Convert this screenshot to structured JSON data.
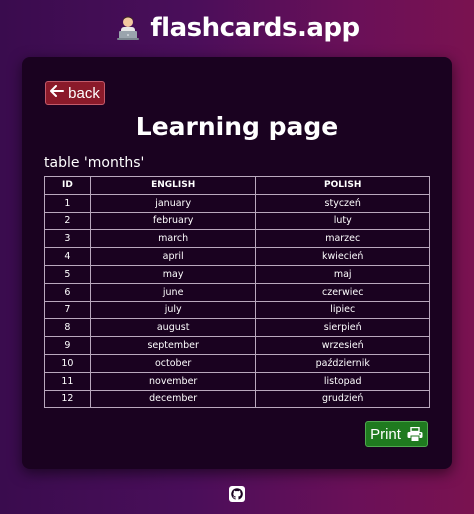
{
  "app": {
    "title": "flashcards.app",
    "logo_icon": "person-at-laptop-icon"
  },
  "card": {
    "back_label": "back",
    "back_icon": "arrow-left-icon",
    "page_title": "Learning page",
    "table_caption": "table 'months'",
    "columns": [
      "ID",
      "ENGLISH",
      "POLISH"
    ],
    "rows": [
      {
        "id": "1",
        "english": "january",
        "polish": "styczeń"
      },
      {
        "id": "2",
        "english": "february",
        "polish": "luty"
      },
      {
        "id": "3",
        "english": "march",
        "polish": "marzec"
      },
      {
        "id": "4",
        "english": "april",
        "polish": "kwiecień"
      },
      {
        "id": "5",
        "english": "may",
        "polish": "maj"
      },
      {
        "id": "6",
        "english": "june",
        "polish": "czerwiec"
      },
      {
        "id": "7",
        "english": "july",
        "polish": "lipiec"
      },
      {
        "id": "8",
        "english": "august",
        "polish": "sierpień"
      },
      {
        "id": "9",
        "english": "september",
        "polish": "wrzesień"
      },
      {
        "id": "10",
        "english": "october",
        "polish": "październik"
      },
      {
        "id": "11",
        "english": "november",
        "polish": "listopad"
      },
      {
        "id": "12",
        "english": "december",
        "polish": "grudzień"
      }
    ],
    "print_label": "Print",
    "print_icon": "printer-icon"
  },
  "footer": {
    "github_icon": "github-icon"
  },
  "colors": {
    "back_button": "#8a1a2a",
    "print_button": "#1f7a1f",
    "card_background": "#1a0220"
  }
}
